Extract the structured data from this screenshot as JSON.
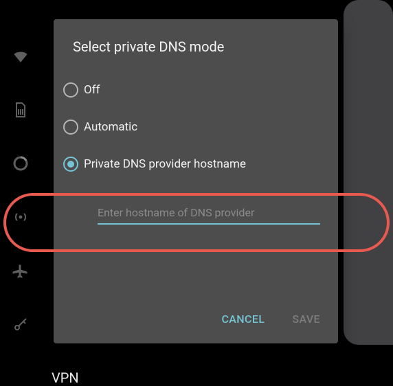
{
  "dialog": {
    "title": "Select private DNS mode",
    "options": [
      {
        "label": "Off",
        "selected": false
      },
      {
        "label": "Automatic",
        "selected": false
      },
      {
        "label": "Private DNS provider hostname",
        "selected": true
      }
    ],
    "input": {
      "value": "",
      "placeholder": "Enter hostname of DNS provider"
    },
    "cancel_label": "CANCEL",
    "save_label": "SAVE"
  },
  "background_list": {
    "vpn_label": "VPN"
  },
  "colors": {
    "accent": "#74c5d6",
    "annotation": "#e85a4f"
  }
}
